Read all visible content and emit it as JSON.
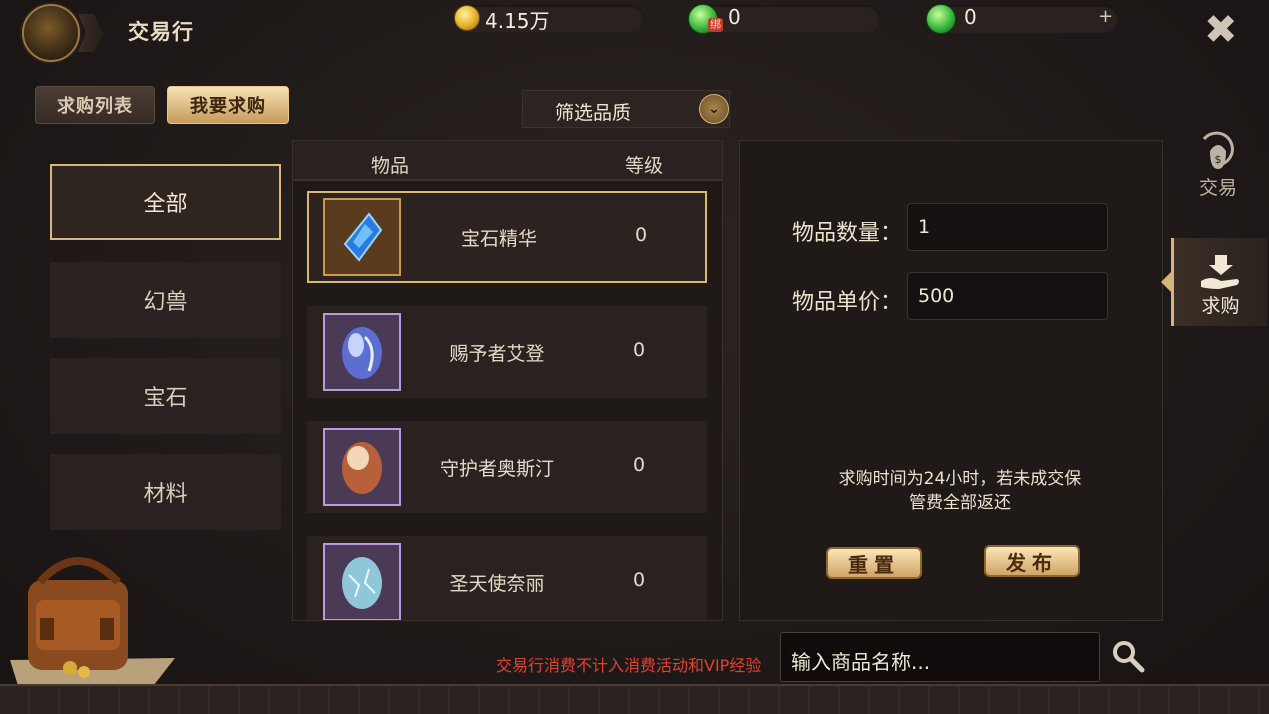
{
  "header": {
    "title": "交易行",
    "gold": "4.15万",
    "bound_gem": "0",
    "bound_tag": "绑",
    "gem": "0",
    "add_symbol": "+",
    "close_symbol": "✖"
  },
  "top_tabs": [
    {
      "label": "求购列表",
      "active": false
    },
    {
      "label": "我要求购",
      "active": true
    }
  ],
  "filter": {
    "label": "筛选品质",
    "chevron": "⌄"
  },
  "categories": [
    {
      "label": "全部",
      "active": true
    },
    {
      "label": "幻兽",
      "active": false
    },
    {
      "label": "宝石",
      "active": false
    },
    {
      "label": "材料",
      "active": false
    }
  ],
  "list": {
    "col_item": "物品",
    "col_level": "等级",
    "rows": [
      {
        "name": "宝石精华",
        "level": "0",
        "icon": "blue-crystal-icon",
        "selected": true
      },
      {
        "name": "赐予者艾登",
        "level": "0",
        "icon": "blue-egg-icon",
        "selected": false
      },
      {
        "name": "守护者奥斯汀",
        "level": "0",
        "icon": "brown-egg-icon",
        "selected": false
      },
      {
        "name": "圣天使奈丽",
        "level": "0",
        "icon": "ice-egg-icon",
        "selected": false
      }
    ]
  },
  "form": {
    "qty_label": "物品数量：",
    "qty_value": "1",
    "price_label": "物品单价：",
    "price_value": "500",
    "notice_line1": "求购时间为24小时，若未成交保",
    "notice_line2": "管费全部返还",
    "reset_label": "重置",
    "publish_label": "发布"
  },
  "side_tabs": [
    {
      "label": "交易",
      "icon": "moneybag-icon",
      "active": false
    },
    {
      "label": "求购",
      "icon": "hand-receive-icon",
      "active": true
    }
  ],
  "footer": {
    "note": "交易行消费不计入消费活动和VIP经验",
    "search_placeholder": "输入商品名称..."
  },
  "colors": {
    "accent_gold": "#d9b77c",
    "warning_red": "#e2412e",
    "rare_purple": "#b89adf"
  }
}
